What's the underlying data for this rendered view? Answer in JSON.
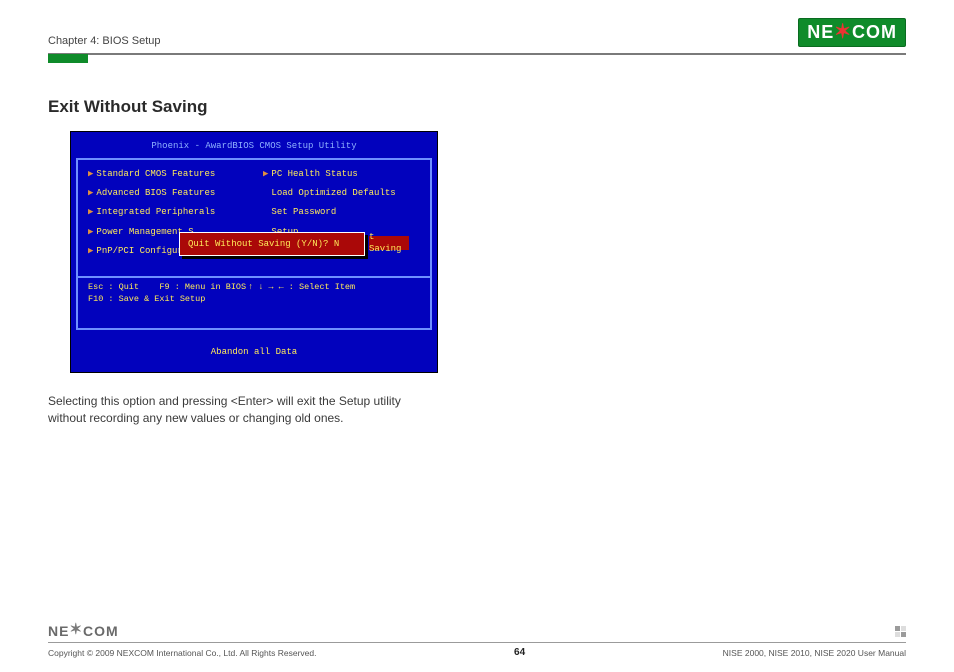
{
  "header": {
    "chapter": "Chapter 4: BIOS Setup",
    "logo_text_1": "NE",
    "logo_text_x": "X",
    "logo_text_2": "COM"
  },
  "section": {
    "title": "Exit Without Saving"
  },
  "bios": {
    "title": "Phoenix - AwardBIOS CMOS Setup Utility",
    "left_items": [
      "Standard CMOS Features",
      "Advanced BIOS Features",
      "Integrated Peripherals",
      "Power Management S",
      "PnP/PCI Configurat"
    ],
    "right_items": [
      "PC Health Status",
      "Load Optimized Defaults",
      "Set Password",
      "Setup"
    ],
    "right_overlay_suffix": "t Saving",
    "dialog_text": "Quit Without Saving (Y/N)? N",
    "help_line1_left": "Esc : Quit",
    "help_line1_mid": "F9 : Menu in BIOS",
    "help_line1_right": "↑ ↓ → ←    : Select Item",
    "help_line2_left": "F10 : Save & Exit Setup",
    "footer": "Abandon all Data"
  },
  "body_text": "Selecting this option and pressing <Enter> will exit the Setup utility without recording any new values or changing old ones.",
  "footer": {
    "logo_text_1": "NE",
    "logo_text_x": "X",
    "logo_text_2": "COM",
    "copyright": "Copyright © 2009 NEXCOM International Co., Ltd. All Rights Reserved.",
    "page_number": "64",
    "manual_title": "NISE 2000, NISE 2010, NISE 2020 User Manual"
  }
}
